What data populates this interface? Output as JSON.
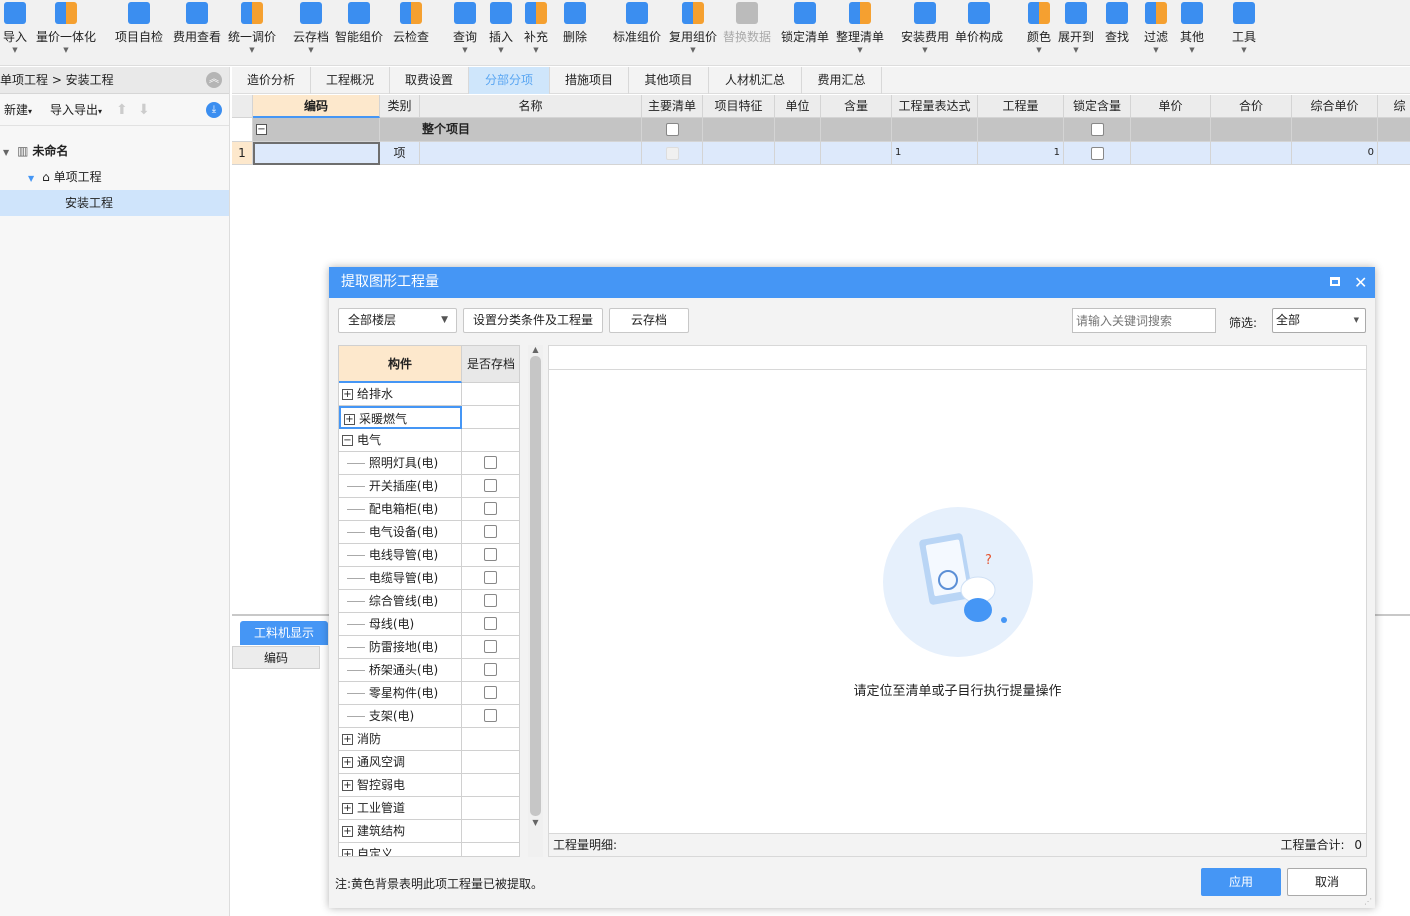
{
  "toolbar": [
    {
      "label": "导入",
      "icon": "import-icon",
      "dropdown": true
    },
    {
      "label": "量价一体化",
      "icon": "quantity-price-icon",
      "dropdown": true
    },
    {
      "label": "项目自检",
      "icon": "self-check-icon",
      "dropdown": false
    },
    {
      "label": "费用查看",
      "icon": "fee-view-icon",
      "dropdown": false
    },
    {
      "label": "统一调价",
      "icon": "adjust-price-icon",
      "dropdown": true
    },
    {
      "label": "云存档",
      "icon": "cloud-upload-icon",
      "dropdown": true
    },
    {
      "label": "智能组价",
      "icon": "smart-price-icon",
      "dropdown": false
    },
    {
      "label": "云检查",
      "icon": "cloud-search-icon",
      "dropdown": false
    },
    {
      "label": "查询",
      "icon": "query-icon",
      "dropdown": true
    },
    {
      "label": "插入",
      "icon": "insert-icon",
      "dropdown": true
    },
    {
      "label": "补充",
      "icon": "supplement-icon",
      "dropdown": true
    },
    {
      "label": "删除",
      "icon": "trash-icon",
      "dropdown": false
    },
    {
      "label": "标准组价",
      "icon": "standard-price-icon",
      "dropdown": false
    },
    {
      "label": "复用组价",
      "icon": "reuse-price-icon",
      "dropdown": true
    },
    {
      "label": "替换数据",
      "icon": "replace-data-icon",
      "dropdown": false,
      "disabled": true
    },
    {
      "label": "锁定清单",
      "icon": "lock-icon",
      "dropdown": false
    },
    {
      "label": "整理清单",
      "icon": "organize-list-icon",
      "dropdown": true
    },
    {
      "label": "安装费用",
      "icon": "install-fee-icon",
      "dropdown": true
    },
    {
      "label": "单价构成",
      "icon": "unit-price-icon",
      "dropdown": false
    },
    {
      "label": "颜色",
      "icon": "paint-bucket-icon",
      "dropdown": true
    },
    {
      "label": "展开到",
      "icon": "expand-icon",
      "dropdown": true
    },
    {
      "label": "查找",
      "icon": "binoculars-icon",
      "dropdown": false
    },
    {
      "label": "过滤",
      "icon": "filter-icon",
      "dropdown": true
    },
    {
      "label": "其他",
      "icon": "grid-apps-icon",
      "dropdown": true
    },
    {
      "label": "工具",
      "icon": "tools-icon",
      "dropdown": true
    }
  ],
  "left": {
    "breadcrumb": "单项工程 > 安装工程",
    "new_label": "新建",
    "import_export_label": "导入导出",
    "tree": [
      {
        "label": "未命名",
        "level": 0
      },
      {
        "label": "单项工程",
        "level": 1
      },
      {
        "label": "安装工程",
        "level": 2,
        "selected": true
      }
    ]
  },
  "tabs": [
    "造价分析",
    "工程概况",
    "取费设置",
    "分部分项",
    "措施项目",
    "其他项目",
    "人材机汇总",
    "费用汇总"
  ],
  "active_tab": "分部分项",
  "grid": {
    "columns": [
      "编码",
      "类别",
      "名称",
      "主要清单",
      "项目特征",
      "单位",
      "含量",
      "工程量表达式",
      "工程量",
      "锁定含量",
      "单价",
      "合价",
      "综合单价",
      "综"
    ],
    "group_row": {
      "name": "整个项目"
    },
    "rows": [
      {
        "num": "1",
        "code": "",
        "type": "项",
        "name": "",
        "expr": "1",
        "qty": "1",
        "composite_price": "0"
      }
    ]
  },
  "bottom": {
    "tab": "工料机显示",
    "col": "编码"
  },
  "dialog": {
    "title": "提取图形工程量",
    "floor_select": "全部楼层",
    "set_button": "设置分类条件及工程量",
    "cloud_button": "云存档",
    "search_placeholder": "请输入关键词搜索",
    "filter_label": "筛选:",
    "filter_value": "全部",
    "tree_headers": [
      "构件",
      "是否存档"
    ],
    "tree": [
      {
        "label": "给排水",
        "type": "collapsed"
      },
      {
        "label": "采暖燃气",
        "type": "collapsed",
        "selected": true
      },
      {
        "label": "电气",
        "type": "expanded"
      },
      {
        "label": "照明灯具(电)",
        "type": "child"
      },
      {
        "label": "开关插座(电)",
        "type": "child"
      },
      {
        "label": "配电箱柜(电)",
        "type": "child"
      },
      {
        "label": "电气设备(电)",
        "type": "child"
      },
      {
        "label": "电线导管(电)",
        "type": "child"
      },
      {
        "label": "电缆导管(电)",
        "type": "child"
      },
      {
        "label": "综合管线(电)",
        "type": "child"
      },
      {
        "label": "母线(电)",
        "type": "child"
      },
      {
        "label": "防雷接地(电)",
        "type": "child"
      },
      {
        "label": "桥架通头(电)",
        "type": "child"
      },
      {
        "label": "零星构件(电)",
        "type": "child"
      },
      {
        "label": "支架(电)",
        "type": "child"
      },
      {
        "label": "消防",
        "type": "collapsed"
      },
      {
        "label": "通风空调",
        "type": "collapsed"
      },
      {
        "label": "智控弱电",
        "type": "collapsed"
      },
      {
        "label": "工业管道",
        "type": "collapsed"
      },
      {
        "label": "建筑结构",
        "type": "collapsed"
      },
      {
        "label": "自定义",
        "type": "collapsed"
      }
    ],
    "empty_message": "请定位至清单或子目行执行提量操作",
    "detail_label": "工程量明细:",
    "total_label": "工程量合计:",
    "total_value": "0",
    "note": "注:黄色背景表明此项工程量已被提取。",
    "apply_button": "应用",
    "cancel_button": "取消"
  },
  "colors": {
    "accent": "#4596f5",
    "header_highlight": "#fde8cc",
    "selected_row": "#dde9fb",
    "group_row": "#c4c4c4"
  }
}
